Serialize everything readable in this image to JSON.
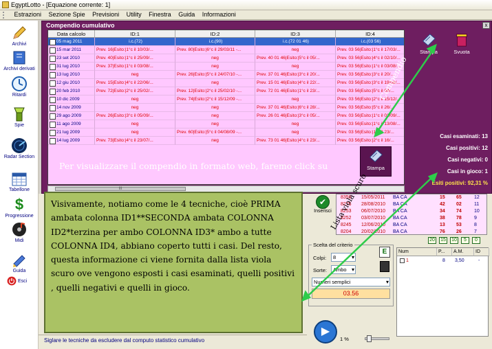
{
  "window": {
    "title": "EgyptLotto - [Equazione corrente: 1]"
  },
  "menu": [
    "Estrazioni",
    "Sezione Spie",
    "Previsioni",
    "Utility",
    "Finestra",
    "Guida",
    "Informazioni"
  ],
  "toolbar": {
    "archivi": "Archivi",
    "archivi_derivati": "Archivi derivati",
    "ritardi": "Ritardi",
    "spie": "Spie",
    "radar": "Radar Section",
    "tabellone": "Tabellone",
    "progressione": "Progressione",
    "midi": "Midi",
    "guida": "Guida",
    "esci": "Esci"
  },
  "compendio": {
    "title": "Compendio cumulativo",
    "close": "x",
    "headers": [
      "Data calcolo",
      "ID:1",
      "ID:2",
      "ID:3",
      "ID:4"
    ],
    "rows": [
      [
        "05 mag 2011",
        "i.c.(72)",
        "i.c.(90)",
        "i.c.(72 01 46)",
        "i.c.(03 56)"
      ],
      [
        "15 mar 2011",
        "Prev. 16|Esito:|1°c il 10/03/...",
        "Prev. 80|Esito:|6°c il 29/03/11 -...",
        "neg",
        "Prev. 03 56|Esito:|1°c il 17/03/..."
      ],
      [
        "23 set 2010",
        "Prev. 40|Esito:|1°c il 25/09/...",
        "neg",
        "Prev. 40 01 46|Esito:|5°c il 05/...",
        "Prev. 03 56|Esito:|4°c il 02/10/..."
      ],
      [
        "31 lug 2010",
        "Prev. 37|Esito:|1°c il 03/08/...",
        "neg",
        "neg",
        "Prev. 03 56|Esito:|1°c il 03/08/..."
      ],
      [
        "13 lug 2010",
        "neg",
        "Prev. 26|Esito:|5°c il 24/07/10 -...",
        "Prev. 37 01 46|Esito:|3°c il 20/...",
        "Prev. 03 56|Esito:|3°c il 20/..."
      ],
      [
        "12 giu 2010",
        "Prev. 15|Esito:|4°c il 22/06/...",
        "neg",
        "Prev. 15 01 46|Esito:|4°c il 22/...",
        "Prev. 03 56|Esito:|3°c il 19/06/..."
      ],
      [
        "20 feb 2010",
        "Prev. 72|Esito:|2°c il 25/02/...",
        "Prev. 12|Esito:|2°c il 25/02/10 -...",
        "Prev. 72 01 46|Esito:|1°c il 23/...",
        "Prev. 03 56|Esito:|5°c il 04/..."
      ],
      [
        "10 dic 2009",
        "neg",
        "Prev. 74|Esito:|2°c il 15/12/09 -...",
        "neg",
        "Prev. 03 56|Esito:|2°c il 15/12/..."
      ],
      [
        "14 nov 2009",
        "neg",
        "neg",
        "Prev. 37 01 46|Esito:|6°c il 28/...",
        "Prev. 03 56|Esito:|5°c il 26/..."
      ],
      [
        "29 ago 2009",
        "Prev. 26|Esito:|3°c il 05/09/...",
        "neg",
        "Prev. 26 01 46|Esito:|3°c il 05/...",
        "Prev. 03 56|Esito:|1°c il 01/09/..."
      ],
      [
        "11 ago 2009",
        "neg",
        "neg",
        "neg",
        "Prev. 03 56|Esito:|1°c il 13/08/..."
      ],
      [
        "21 lug 2009",
        "neg",
        "Prev. 60|Esito:|5°c il 04/08/09 -...",
        "neg",
        "Prev. 03 56|Esito:|1°c il 23/..."
      ],
      [
        "14 lug 2009",
        "Prev. 73|Esito:|4°c il 23/07/...",
        "neg",
        "Prev. 73 01 46|Esito:|4°c il 23/...",
        "Prev. 03 56|Esito:|2°c il 16/..."
      ]
    ],
    "scroll_mark": "III",
    "stampa": "Stampa",
    "svuota": "Svuota",
    "stampa_web": "Stampa",
    "stats": {
      "esaminati": "Casi esaminati: 13",
      "positivi": "Casi positivi: 12",
      "negativi": "Casi negativi: 0",
      "in_gioco": "Casi in gioco: 1",
      "esiti_positivi": "Esiti positivi: 92,31 %"
    },
    "note_web": "Per visualizzare il compendio in formato web, faremo click su",
    "note_compendio": "Compendio",
    "note_lista": "Lista viola scuro"
  },
  "explanation": "Visivamente, notiamo come le 4 tecniche, cioè PRIMA ambata colonna ID1**SECONDA ambata COLONNA ID2*terzina per ambo COLONNA ID3* ambo a tutte COLONNA ID4, abbiano coperto tutti i casi. Del resto, questa informazione ci viene fornita dalla lista viola scuro ove vengono esposti i casi esaminati, quelli positivi , quelli negativi e quelli in gioco.",
  "statusbar": "Siglare le tecniche da escludere dal computo statistico cumulativo",
  "inserisci": "Inserisci",
  "estrazioni": [
    [
      "8350",
      "15/05/2011",
      "BA CA",
      "15",
      "65",
      "12"
    ],
    [
      "8276",
      "28/08/2010",
      "BA CA",
      "42",
      "02",
      "11"
    ],
    [
      "8253",
      "06/07/2010",
      "BA CA",
      "34",
      "74",
      "10"
    ],
    [
      "8252",
      "03/07/2010",
      "BA CA",
      "38",
      "78",
      "9"
    ],
    [
      "8245",
      "12/06/2010",
      "BA CA",
      "13",
      "53",
      "8"
    ],
    [
      "8204",
      "20/02/2010",
      "BA CA",
      "76",
      "26",
      "7"
    ]
  ],
  "counters": [
    "20",
    "15",
    "10",
    "5",
    "0"
  ],
  "scelta": {
    "title": "Scelta del criterio",
    "colpi_label": "Colpi:",
    "colpi_value": "8",
    "sorte_label": "Sorte:",
    "sorte_value": "Ambo",
    "e_button": "E",
    "tipo_value": "Numeri semplici",
    "numeri": "03.56"
  },
  "percent": "1 %",
  "numgrid": {
    "headers": [
      "Num",
      "P...",
      "A.M.",
      "ID"
    ],
    "rows": [
      [
        "1",
        "8",
        "3,50",
        "-"
      ]
    ]
  }
}
